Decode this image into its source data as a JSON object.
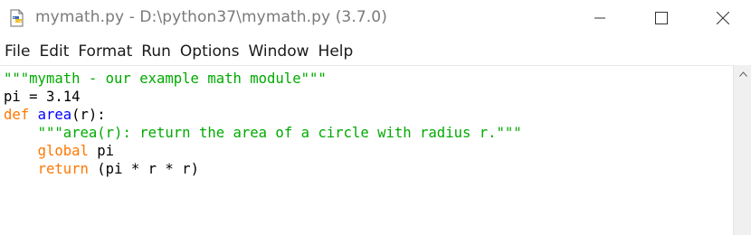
{
  "window": {
    "title": "mymath.py - D:\\python37\\mymath.py (3.7.0)",
    "icons": {
      "app": "python-file-icon",
      "minimize": "minimize-icon",
      "maximize": "maximize-icon",
      "close": "close-icon",
      "scroll_up": "scroll-up-arrow-icon"
    }
  },
  "menu": {
    "items": [
      "File",
      "Edit",
      "Format",
      "Run",
      "Options",
      "Window",
      "Help"
    ]
  },
  "editor": {
    "lines": [
      [
        {
          "t": "\"\"\"mymath - our example math module\"\"\"",
          "c": "str"
        }
      ],
      [
        {
          "t": "pi = 3.14",
          "c": ""
        }
      ],
      [
        {
          "t": "def",
          "c": "kw"
        },
        {
          "t": " ",
          "c": ""
        },
        {
          "t": "area",
          "c": "def"
        },
        {
          "t": "(r):",
          "c": ""
        }
      ],
      [
        {
          "t": "    ",
          "c": ""
        },
        {
          "t": "\"\"\"area(r): return the area of a circle with radius r.\"\"\"",
          "c": "str"
        }
      ],
      [
        {
          "t": "    ",
          "c": ""
        },
        {
          "t": "global",
          "c": "kw"
        },
        {
          "t": " pi",
          "c": ""
        }
      ],
      [
        {
          "t": "    ",
          "c": ""
        },
        {
          "t": "return",
          "c": "kw"
        },
        {
          "t": " (pi * r * r)",
          "c": ""
        }
      ]
    ]
  },
  "colors": {
    "keyword": "#ff7700",
    "string": "#00aa00",
    "definition": "#0000ff",
    "title_text": "#7a7a7a"
  }
}
